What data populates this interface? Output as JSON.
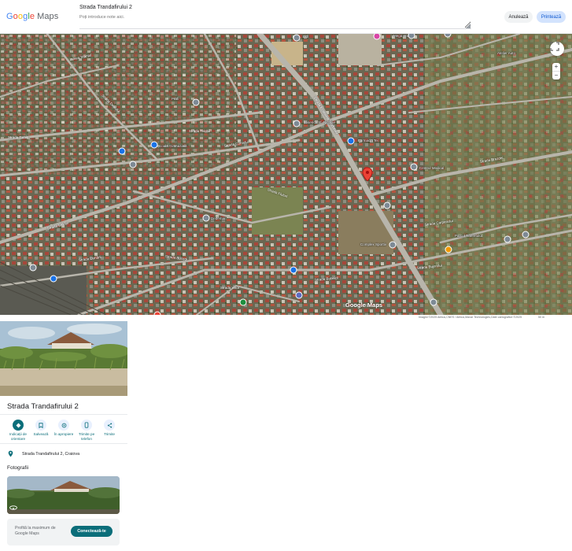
{
  "header": {
    "logo": {
      "g": "G",
      "o1": "o",
      "o2": "o",
      "g2": "g",
      "l": "l",
      "e": "e",
      "maps": "Maps"
    },
    "title": "Strada Trandafirului 2",
    "notes_placeholder": "Poți introduce note aici.",
    "cancel_label": "Anulează",
    "print_label": "Printează"
  },
  "map": {
    "zoom_in": "+",
    "zoom_out": "−",
    "logo": "Google Maps",
    "attribution": "Imagini ©2025 Airbus,CNES / Airbus,Maxar Technologies,Date cartografice ©2025",
    "scale": "50 m",
    "street_labels": [
      "Strada Tomis",
      "Aleea Sfântul",
      "Strada Ecaterina Teodoroiu",
      "Strada Teiului",
      "Strada Cornului",
      "Strada Fluturi",
      "Strada Dunării",
      "Strada Bucegi",
      "Strada Viilor",
      "Strada Brazdei",
      "Strada Carpenului",
      "Strada Bobeicii",
      "Strada Sălciei",
      "Strada Dealului",
      "Strada Bujorului"
    ],
    "poi_labels": [
      "Lidl",
      "Mega Image",
      "Profi",
      "Biserica Sf. Nicolae",
      "Școala Gimnazială",
      "Farmacia Tei",
      "Centrul Medical",
      "Dedeman",
      "Complex Sportiv",
      "Atelier Auto",
      "Parcul Tineretului"
    ],
    "pin_color": "#ea4335"
  },
  "panel": {
    "title": "Strada Trandafirului 2",
    "actions": [
      {
        "label_line1": "Indicații de",
        "label_line2": "orientare",
        "icon": "directions-icon"
      },
      {
        "label_line1": "Salvează",
        "label_line2": "",
        "icon": "bookmark-icon"
      },
      {
        "label_line1": "În apropiere",
        "label_line2": "",
        "icon": "nearby-icon"
      },
      {
        "label_line1": "Trimite pe",
        "label_line2": "telefon",
        "icon": "phone-icon"
      },
      {
        "label_line1": "Trimite",
        "label_line2": "",
        "icon": "share-icon"
      }
    ],
    "address": "Strada Trandafirului 2, Craiova",
    "photos_heading": "Fotografii",
    "signin_text": "Profită la maximum de Google Maps",
    "signin_button": "Conectează-te",
    "accent": "#0b6e7a"
  }
}
